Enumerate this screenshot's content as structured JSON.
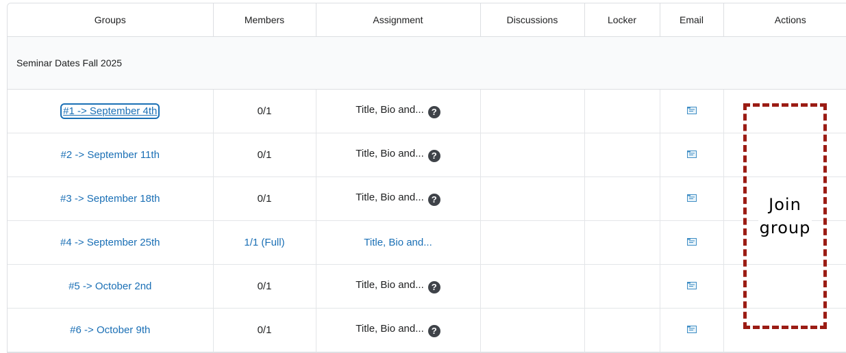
{
  "table": {
    "headers": {
      "groups": "Groups",
      "members": "Members",
      "assignment": "Assignment",
      "discussions": "Discussions",
      "locker": "Locker",
      "email": "Email",
      "actions": "Actions"
    },
    "category": "Seminar Dates Fall 2025",
    "rows": [
      {
        "group": "#1 -> September 4th",
        "members": "0/1",
        "assignment": "Title, Bio and...",
        "assignment_help": true,
        "full": false
      },
      {
        "group": "#2 -> September 11th",
        "members": "0/1",
        "assignment": "Title, Bio and...",
        "assignment_help": true,
        "full": false
      },
      {
        "group": "#3 -> September 18th",
        "members": "0/1",
        "assignment": "Title, Bio and...",
        "assignment_help": true,
        "full": false
      },
      {
        "group": "#4 -> September 25th",
        "members": "1/1 (Full)",
        "assignment": "Title, Bio and...",
        "assignment_help": false,
        "full": true
      },
      {
        "group": "#5 -> October 2nd",
        "members": "0/1",
        "assignment": "Title, Bio and...",
        "assignment_help": true,
        "full": false
      },
      {
        "group": "#6 -> October 9th",
        "members": "0/1",
        "assignment": "Title, Bio and...",
        "assignment_help": true,
        "full": false
      }
    ],
    "help_glyph": "?",
    "icons": {
      "help": "question-circle-icon",
      "email": "email-icon"
    }
  },
  "callout": {
    "line1": "Join",
    "line2": "group",
    "border_color": "#9b1c14"
  },
  "colors": {
    "link": "#1a6fb5",
    "header_bg": "#f9fafb",
    "border": "#dcdee2"
  }
}
